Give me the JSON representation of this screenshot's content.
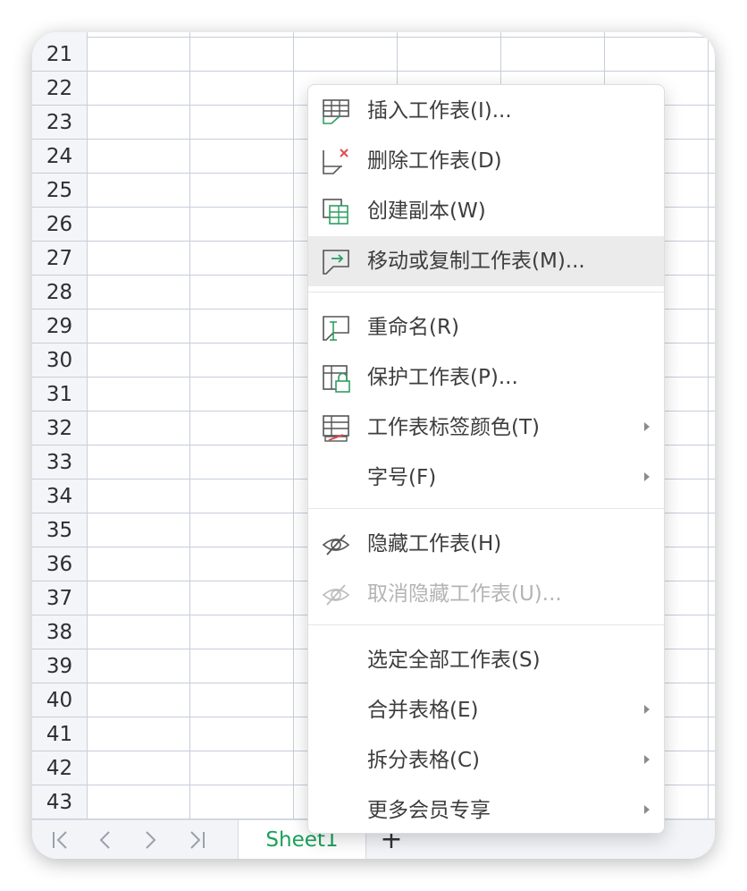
{
  "rows": [
    "21",
    "22",
    "23",
    "24",
    "25",
    "26",
    "27",
    "28",
    "29",
    "30",
    "31",
    "32",
    "33",
    "34",
    "35",
    "36",
    "37",
    "38",
    "39",
    "40",
    "41",
    "42",
    "43"
  ],
  "tabbar": {
    "first_icon": "first-sheet-icon",
    "prev_icon": "prev-sheet-icon",
    "next_icon": "next-sheet-icon",
    "last_icon": "last-sheet-icon",
    "sheet_name": "Sheet1",
    "add_label": "+"
  },
  "menu": {
    "items": [
      {
        "label": "插入工作表(I)...",
        "icon": "insert-sheet-icon"
      },
      {
        "label": "删除工作表(D)",
        "icon": "delete-sheet-icon"
      },
      {
        "label": "创建副本(W)",
        "icon": "copy-sheet-icon"
      },
      {
        "label": "移动或复制工作表(M)...",
        "icon": "move-sheet-icon"
      },
      {
        "label": "重命名(R)",
        "icon": "rename-icon"
      },
      {
        "label": "保护工作表(P)...",
        "icon": "protect-sheet-icon"
      },
      {
        "label": "工作表标签颜色(T)",
        "icon": "tab-color-icon"
      },
      {
        "label": "字号(F)"
      },
      {
        "label": "隐藏工作表(H)",
        "icon": "hide-icon"
      },
      {
        "label": "取消隐藏工作表(U)...",
        "icon": "unhide-icon"
      },
      {
        "label": "选定全部工作表(S)"
      },
      {
        "label": "合并表格(E)"
      },
      {
        "label": "拆分表格(C)"
      },
      {
        "label": "更多会员专享"
      }
    ]
  },
  "colors": {
    "accent": "#1aa15a",
    "icon_green": "#2e9e62",
    "delete_red": "#e04c4c"
  }
}
